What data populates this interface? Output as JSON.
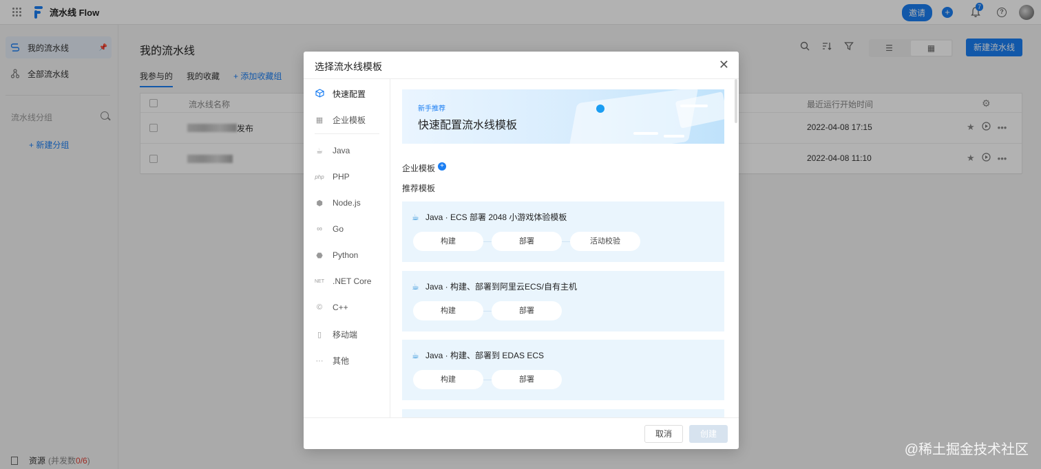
{
  "app": {
    "title": "流水线 Flow"
  },
  "topbar": {
    "invite_label": "邀请",
    "bell_badge": "7",
    "help_glyph": "?"
  },
  "sidebar": {
    "items": [
      {
        "label": "我的流水线"
      },
      {
        "label": "全部流水线"
      }
    ],
    "group_header": "流水线分组",
    "new_group": "+ 新建分组",
    "resource": {
      "label": "资源",
      "sub_prefix": "(并发数",
      "count": "0/6",
      "sub_suffix": ")"
    }
  },
  "main": {
    "title": "我的流水线",
    "tabs": [
      {
        "label": "我参与的"
      },
      {
        "label": "我的收藏"
      },
      {
        "label": "+ 添加收藏组"
      }
    ],
    "new_button": "新建流水线",
    "table": {
      "headers": {
        "name": "流水线名称",
        "time": "最近运行开始时间"
      },
      "rows": [
        {
          "name_tail": "发布",
          "time": "2022-04-08 17:15"
        },
        {
          "name_tail": "",
          "time": "2022-04-08 11:10"
        }
      ]
    }
  },
  "modal": {
    "title": "选择流水线模板",
    "categories": [
      {
        "label": "快速配置",
        "icon": "cube-icon"
      },
      {
        "label": "企业模板",
        "icon": "grid-icon"
      },
      {
        "label": "Java",
        "icon": "java-icon"
      },
      {
        "label": "PHP",
        "icon": "php-icon"
      },
      {
        "label": "Node.js",
        "icon": "nodejs-icon"
      },
      {
        "label": "Go",
        "icon": "go-icon"
      },
      {
        "label": "Python",
        "icon": "python-icon"
      },
      {
        "label": ".NET Core",
        "icon": "dotnet-icon"
      },
      {
        "label": "C++",
        "icon": "cpp-icon"
      },
      {
        "label": "移动端",
        "icon": "mobile-icon"
      },
      {
        "label": "其他",
        "icon": "more-icon"
      }
    ],
    "banner": {
      "tag": "新手推荐",
      "title": "快速配置流水线模板"
    },
    "enterprise_label": "企业模板",
    "recommended_label": "推荐模板",
    "templates": [
      {
        "title": "Java · ECS 部署 2048 小游戏体验模板",
        "stages": [
          "构建",
          "部署",
          "活动校验"
        ]
      },
      {
        "title": "Java · 构建、部署到阿里云ECS/自有主机",
        "stages": [
          "构建",
          "部署"
        ]
      },
      {
        "title": "Java · 构建、部署到 EDAS ECS",
        "stages": [
          "构建",
          "部署"
        ]
      }
    ],
    "cancel_label": "取消",
    "create_label": "创建"
  },
  "watermark": "@稀土掘金技术社区"
}
